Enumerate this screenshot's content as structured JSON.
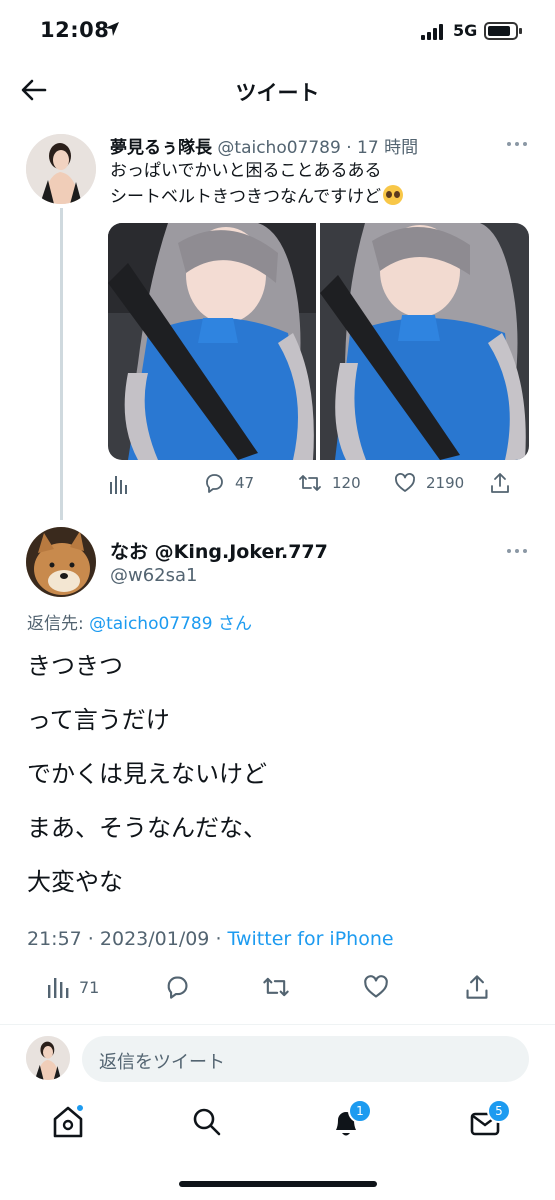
{
  "status_bar": {
    "time": "12:08",
    "network": "5G"
  },
  "header": {
    "title": "ツイート"
  },
  "original_tweet": {
    "display_name": "夢見るぅ隊長",
    "handle": "@taicho07789",
    "time_ago": "17 時間",
    "text_line1": "おっぱいでかいと困ることあるある",
    "text_line2": "シートベルトきつきつなんですけど",
    "emoji": "pleading-face",
    "images": [
      "selfie-in-car-blue-sweater-1",
      "selfie-in-car-blue-sweater-2"
    ],
    "stats": {
      "replies": "47",
      "retweets": "120",
      "likes": "2190"
    }
  },
  "reply_tweet": {
    "display_name": "なお @King.Joker.777",
    "handle": "@w62sa1",
    "replying_to_prefix": "返信先: ",
    "replying_to_handle": "@taicho07789 さん",
    "lines": [
      "きつきつ",
      "って言うだけ",
      "でかくは見えないけど",
      "まあ、そうなんだな、",
      "大変やな"
    ],
    "time": "21:57",
    "date": "2023/01/09",
    "source": "Twitter for iPhone",
    "views": "71"
  },
  "reply_input": {
    "placeholder": "返信をツイート"
  },
  "tab_bar": {
    "notifications_badge": "1",
    "messages_badge": "5"
  },
  "colors": {
    "accent": "#1d9bf0",
    "text": "#0f1419",
    "muted": "#536471"
  }
}
